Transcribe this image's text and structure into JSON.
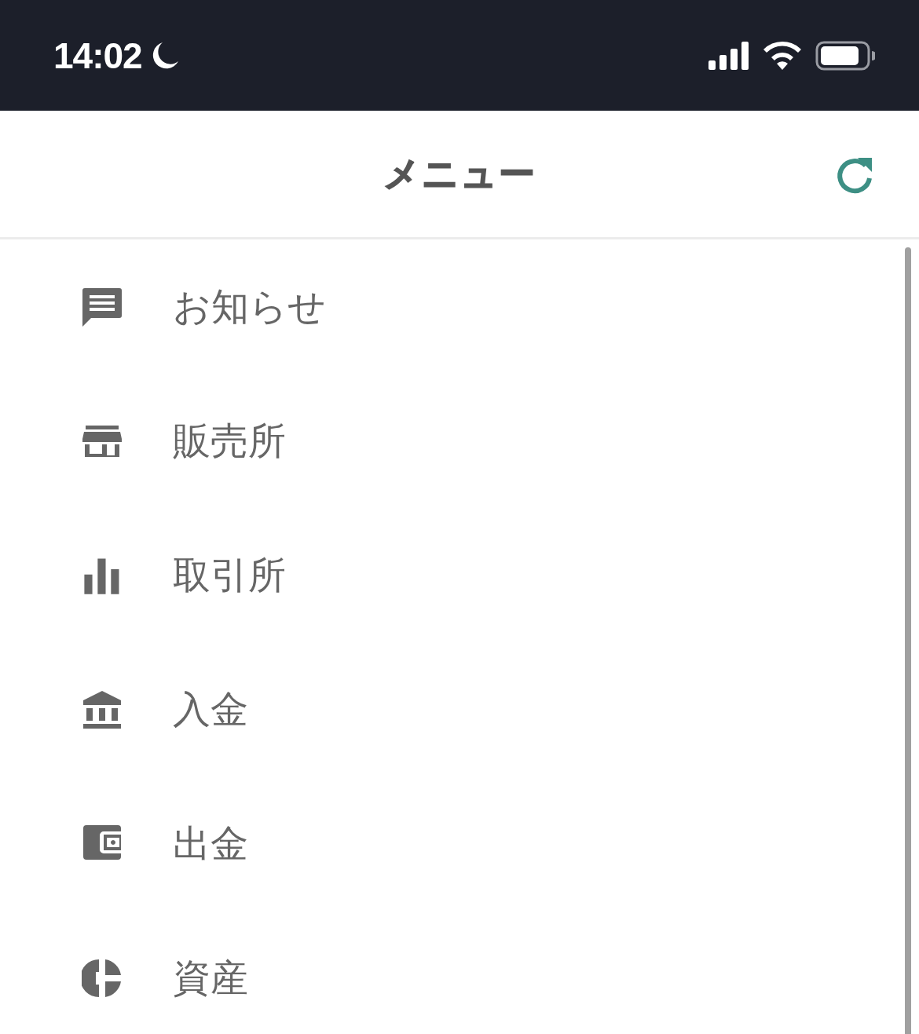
{
  "status_bar": {
    "time": "14:02"
  },
  "header": {
    "title": "メニュー"
  },
  "menu": {
    "items": [
      {
        "label": "お知らせ"
      },
      {
        "label": "販売所"
      },
      {
        "label": "取引所"
      },
      {
        "label": "入金"
      },
      {
        "label": "出金"
      },
      {
        "label": "資産"
      }
    ]
  }
}
